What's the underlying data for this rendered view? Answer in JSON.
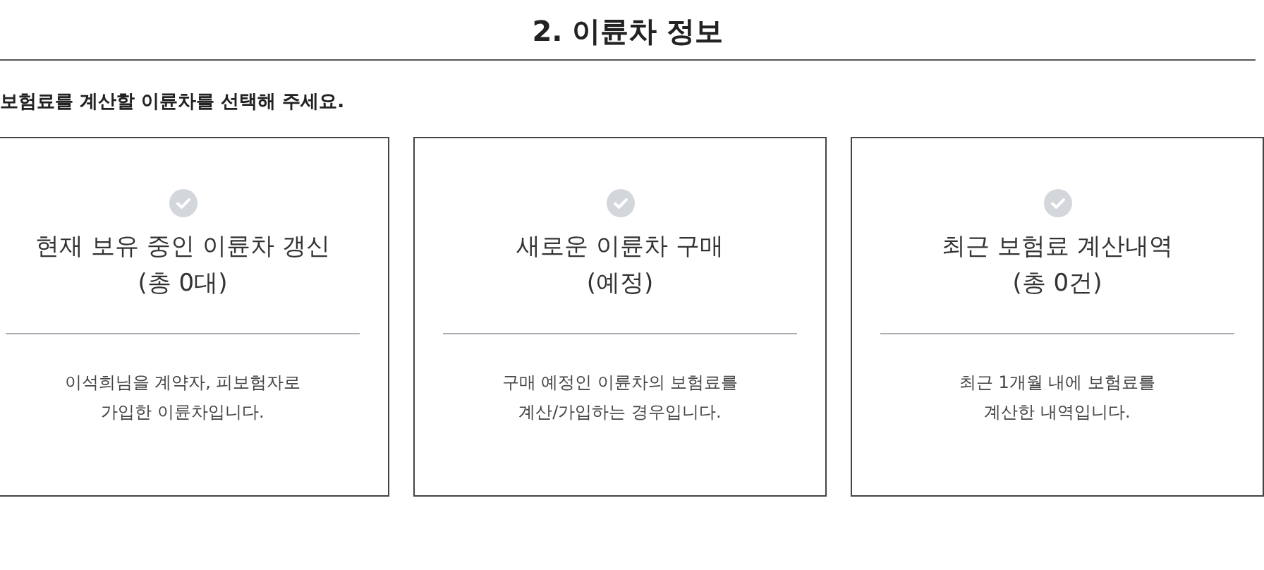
{
  "heading": "2. 이륜차 정보",
  "instruction": "보험료를 계산할 이륜차를 선택해 주세요.",
  "options": [
    {
      "title_lines": [
        "현재 보유 중인 이륜차 갱신",
        "(총 0대)"
      ],
      "description_lines": [
        "이석희님을 계약자, 피보험자로",
        "가입한 이륜차입니다."
      ],
      "selected": false
    },
    {
      "title_lines": [
        "새로운 이륜차 구매",
        "(예정)"
      ],
      "description_lines": [
        "구매 예정인 이륜차의 보험료를",
        "계산/가입하는 경우입니다."
      ],
      "selected": false
    },
    {
      "title_lines": [
        "최근 보험료 계산내역",
        "(총 0건)"
      ],
      "description_lines": [
        "최근 1개월 내에 보험료를",
        "계산한 내역입니다."
      ],
      "selected": false
    }
  ]
}
